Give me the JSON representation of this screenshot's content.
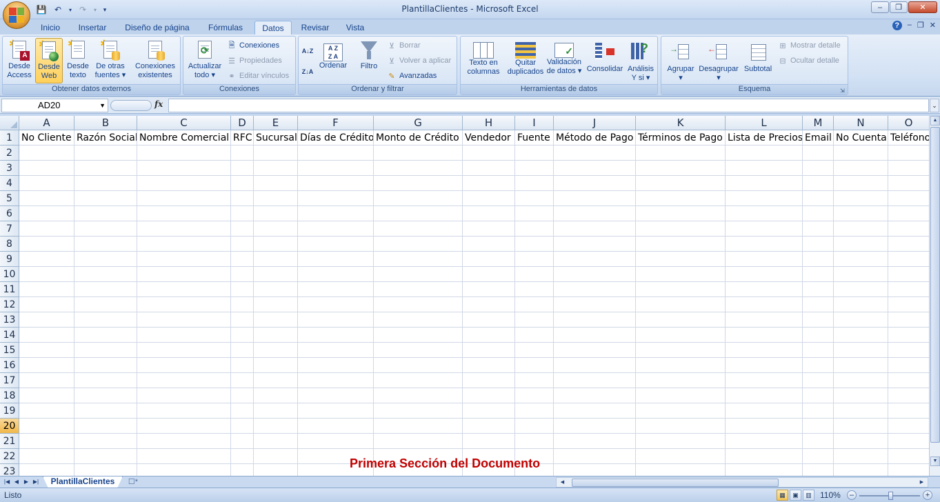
{
  "app": {
    "title": "PlantillaClientes - Microsoft Excel",
    "window_buttons": [
      "–",
      "❐",
      "✕"
    ]
  },
  "tabs": [
    {
      "label": "Inicio"
    },
    {
      "label": "Insertar"
    },
    {
      "label": "Diseño de página"
    },
    {
      "label": "Fórmulas"
    },
    {
      "label": "Datos",
      "active": true
    },
    {
      "label": "Revisar"
    },
    {
      "label": "Vista"
    }
  ],
  "ribbon": {
    "groups": {
      "externos": {
        "label": "Obtener datos externos"
      },
      "conexiones": {
        "label": "Conexiones"
      },
      "ordenar": {
        "label": "Ordenar y filtrar"
      },
      "herramientas": {
        "label": "Herramientas de datos"
      },
      "esquema": {
        "label": "Esquema"
      }
    },
    "buttons": {
      "desde_access": "Desde\nAccess",
      "desde_web": "Desde\nWeb",
      "desde_texto": "Desde\ntexto",
      "otras_fuentes": "De otras\nfuentes ▾",
      "conexiones_existentes": "Conexiones\nexistentes",
      "actualizar": "Actualizar\ntodo ▾",
      "conexiones": "Conexiones",
      "propiedades": "Propiedades",
      "editar_vinculos": "Editar vínculos",
      "ordenar": "Ordenar",
      "filtro": "Filtro",
      "borrar": "Borrar",
      "volver_aplicar": "Volver a aplicar",
      "avanzadas": "Avanzadas",
      "texto_columnas": "Texto en\ncolumnas",
      "quitar_duplicados": "Quitar\nduplicados",
      "validacion": "Validación\nde datos ▾",
      "consolidar": "Consolidar",
      "analisis": "Análisis\nY si ▾",
      "agrupar": "Agrupar\n▾",
      "desagrupar": "Desagrupar\n▾",
      "subtotal": "Subtotal",
      "mostrar_detalle": "Mostrar detalle",
      "ocultar_detalle": "Ocultar detalle"
    }
  },
  "formula_bar": {
    "name_box": "AD20",
    "fx": "fx",
    "value": ""
  },
  "grid": {
    "columns": [
      "A",
      "B",
      "C",
      "D",
      "E",
      "F",
      "G",
      "H",
      "I",
      "J",
      "K",
      "L",
      "M",
      "N",
      "O"
    ],
    "rows": [
      "1",
      "2",
      "3",
      "4",
      "5",
      "6",
      "7",
      "8",
      "9",
      "10",
      "11",
      "12",
      "13",
      "14",
      "15",
      "16",
      "17",
      "18",
      "19",
      "20",
      "21",
      "22",
      "23"
    ],
    "selected_row": "20",
    "headers_row1": [
      "No Cliente",
      "Razón Social",
      "Nombre Comercial",
      "RFC",
      "Sucursal",
      "Días de Crédito",
      "Monto de Crédito",
      "Vendedor",
      "Fuente",
      "Método de Pago",
      "Términos de Pago",
      "Lista de Precios",
      "Email",
      "No Cuenta",
      "Teléfono"
    ]
  },
  "overlay_text": "Primera Sección del Documento",
  "sheet_tabs": {
    "active": "PlantillaClientes"
  },
  "status_bar": {
    "status": "Listo",
    "zoom": "110%",
    "zoom_percent": 110
  },
  "colors": {
    "accent": "#15428b",
    "overlay_text": "#c00000",
    "selected_header": "#f1b84a"
  }
}
